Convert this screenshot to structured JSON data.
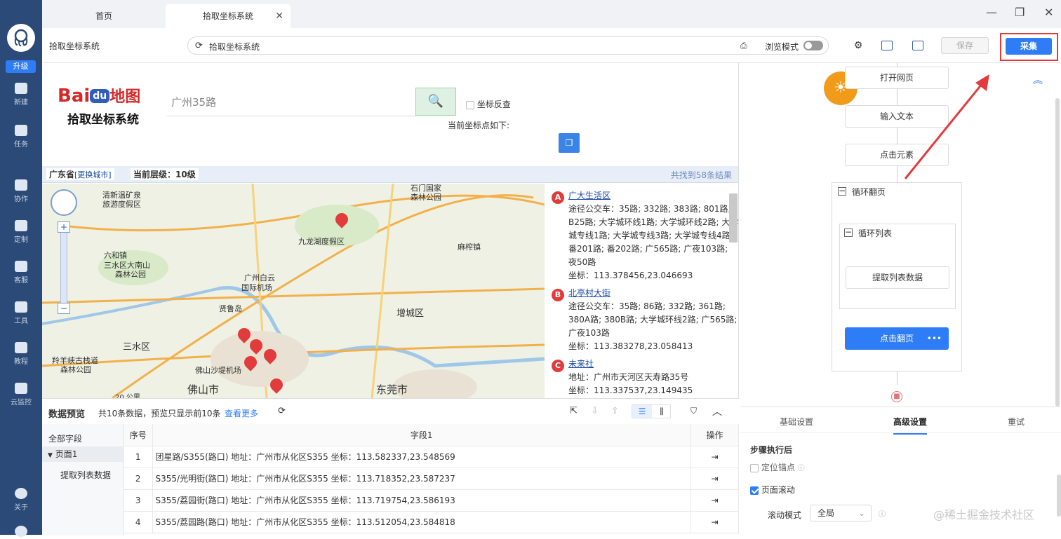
{
  "rail": {
    "upgrade": "升级",
    "items": [
      "新建",
      "任务",
      "协作",
      "定制",
      "客服",
      "工具",
      "教程",
      "云监控",
      "关于"
    ]
  },
  "tabs": {
    "home": "首页",
    "active": "拾取坐标系统"
  },
  "toolbar": {
    "page_title": "拾取坐标系统",
    "url": "拾取坐标系统",
    "browse_mode": "浏览模式",
    "save": "保存",
    "collect": "采集"
  },
  "web": {
    "logo_top": "Bai",
    "logo_du": "du",
    "logo_map": "地图",
    "logo_sub": "拾取坐标系统",
    "search_value": "广州35路",
    "reverse_label": "坐标反查",
    "current_coord": "当前坐标点如下:",
    "province": "广东省",
    "change_city": "[更换城市]",
    "level": "当前层级：10级",
    "found": "共找到58条结果",
    "map_labels": [
      "清新温矿泉",
      "旅游度假区",
      "石门国家",
      "森林公园",
      "六和镇",
      "三水区大南山",
      "森林公园",
      "九龙湖度假区",
      "广州白云",
      "国际机场",
      "贤鲁岛",
      "麻榨镇",
      "增城区",
      "三水区",
      "羚羊峡古栈道",
      "森林公园",
      "佛山沙堤机场",
      "佛山市",
      "东莞市",
      "20 公里"
    ],
    "results": [
      {
        "mark": "A",
        "name": "广大生活区",
        "l1": "途径公交车：35路; 332路; 383路; 801路; B25路; 大学城环线1路; 大学城环线2路; 大学城专线1路; 大学城专线3路; 大学城专线4路; 番201路; 番202路; 广565路; 广夜103路; 夜50路",
        "coord": "坐标：113.378456,23.046693"
      },
      {
        "mark": "B",
        "name": "北亭村大街",
        "l1": "途径公交车：35路; 86路; 332路; 361路; 380A路; 380B路; 大学城环线2路; 广565路; 广夜103路",
        "coord": "坐标：113.383278,23.058413"
      },
      {
        "mark": "C",
        "name": "未来社",
        "l1": "地址：广州市天河区天寿路35号",
        "coord": "坐标：113.337537,23.149435"
      }
    ]
  },
  "preview": {
    "title": "数据预览",
    "summary": "共10条数据，预览只显示前10条",
    "more": "查看更多",
    "all_fields": "全部字段",
    "page1": "页面1",
    "extract": "提取列表数据",
    "col_index": "序号",
    "col_field": "字段1",
    "col_op": "操作",
    "rows": [
      {
        "i": "1",
        "v": "团星路/S355(路口) 地址：广州市从化区S355 坐标：113.582337,23.548569"
      },
      {
        "i": "2",
        "v": "S355/光明街(路口) 地址：广州市从化区S355 坐标：113.718352,23.587237"
      },
      {
        "i": "3",
        "v": "S355/荔园街(路口) 地址：广州市从化区S355 坐标：113.719754,23.586193"
      },
      {
        "i": "4",
        "v": "S355/荔园路(路口) 地址：广州市从化区S355 坐标：113.512054,23.584818"
      }
    ]
  },
  "flow": {
    "open": "打开网页",
    "input": "输入文本",
    "click": "点击元素",
    "loop_page": "循环翻页",
    "loop_list": "循环列表",
    "extract": "提取列表数据",
    "next_page": "点击翻页",
    "more": "•••"
  },
  "settings": {
    "tab_basic": "基础设置",
    "tab_adv": "高级设置",
    "tab_retry": "重试",
    "after": "步骤执行后",
    "anchor": "定位锚点",
    "scroll": "页面滚动",
    "scroll_mode": "滚动模式",
    "scroll_value": "全局",
    "watermark": "@稀土掘金技术社区"
  }
}
